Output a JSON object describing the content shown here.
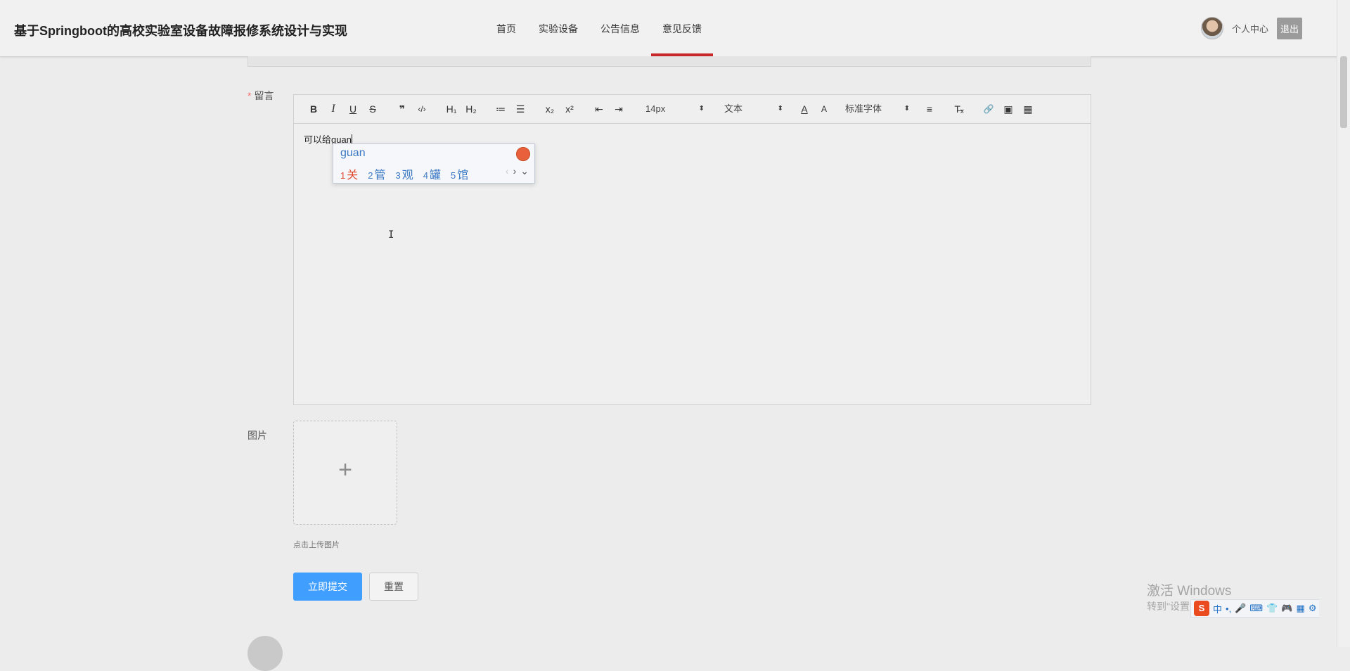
{
  "header": {
    "site_title": "基于Springboot的高校实验室设备故障报修系统设计与实现",
    "nav": [
      {
        "label": "首页"
      },
      {
        "label": "实验设备"
      },
      {
        "label": "公告信息"
      },
      {
        "label": "意见反馈",
        "active": true
      }
    ],
    "user_center": "个人中心",
    "logout": "退出"
  },
  "form": {
    "message_label": "留言",
    "required_mark": "*",
    "editor": {
      "toolbar": {
        "bold": "B",
        "italic": "I",
        "underline": "U",
        "strike": "S",
        "blockquote": "❞",
        "code": "‹/›",
        "h1": "H₁",
        "h2": "H₂",
        "ordered_list": "≔",
        "bullet_list": "☰",
        "subscript": "x₂",
        "superscript": "x²",
        "outdent": "⇤",
        "indent": "⇥",
        "size_select": "14px",
        "header_select": "文本",
        "color": "A",
        "background": "A",
        "font_select": "标准字体",
        "align": "≡",
        "clean": "T̶ₓ",
        "link": "🔗",
        "image": "▣",
        "video": "▦"
      },
      "content": "可以给guan"
    },
    "ime": {
      "pinyin": "guan",
      "candidates": [
        {
          "num": "1",
          "char": "关"
        },
        {
          "num": "2",
          "char": "管"
        },
        {
          "num": "3",
          "char": "观"
        },
        {
          "num": "4",
          "char": "罐"
        },
        {
          "num": "5",
          "char": "馆"
        }
      ],
      "prev": "‹",
      "next": "›",
      "expand": "⌄"
    },
    "image_label": "图片",
    "upload_plus": "+",
    "upload_hint": "点击上传图片",
    "submit": "立即提交",
    "reset": "重置"
  },
  "watermark": {
    "line1": "激活 Windows",
    "line2": "转到\"设置\"以激活 Windows。"
  },
  "ime_bar": {
    "logo": "S",
    "items": [
      "中",
      "•,",
      "🎤",
      "⌨",
      "👕",
      "🎮",
      "▦",
      "⚙"
    ]
  },
  "colors": {
    "accent": "#c8282a",
    "primary_button": "#409eff",
    "required": "#f56c6c",
    "ime_text": "#3b78c4",
    "ime_first": "#e04a2e"
  }
}
